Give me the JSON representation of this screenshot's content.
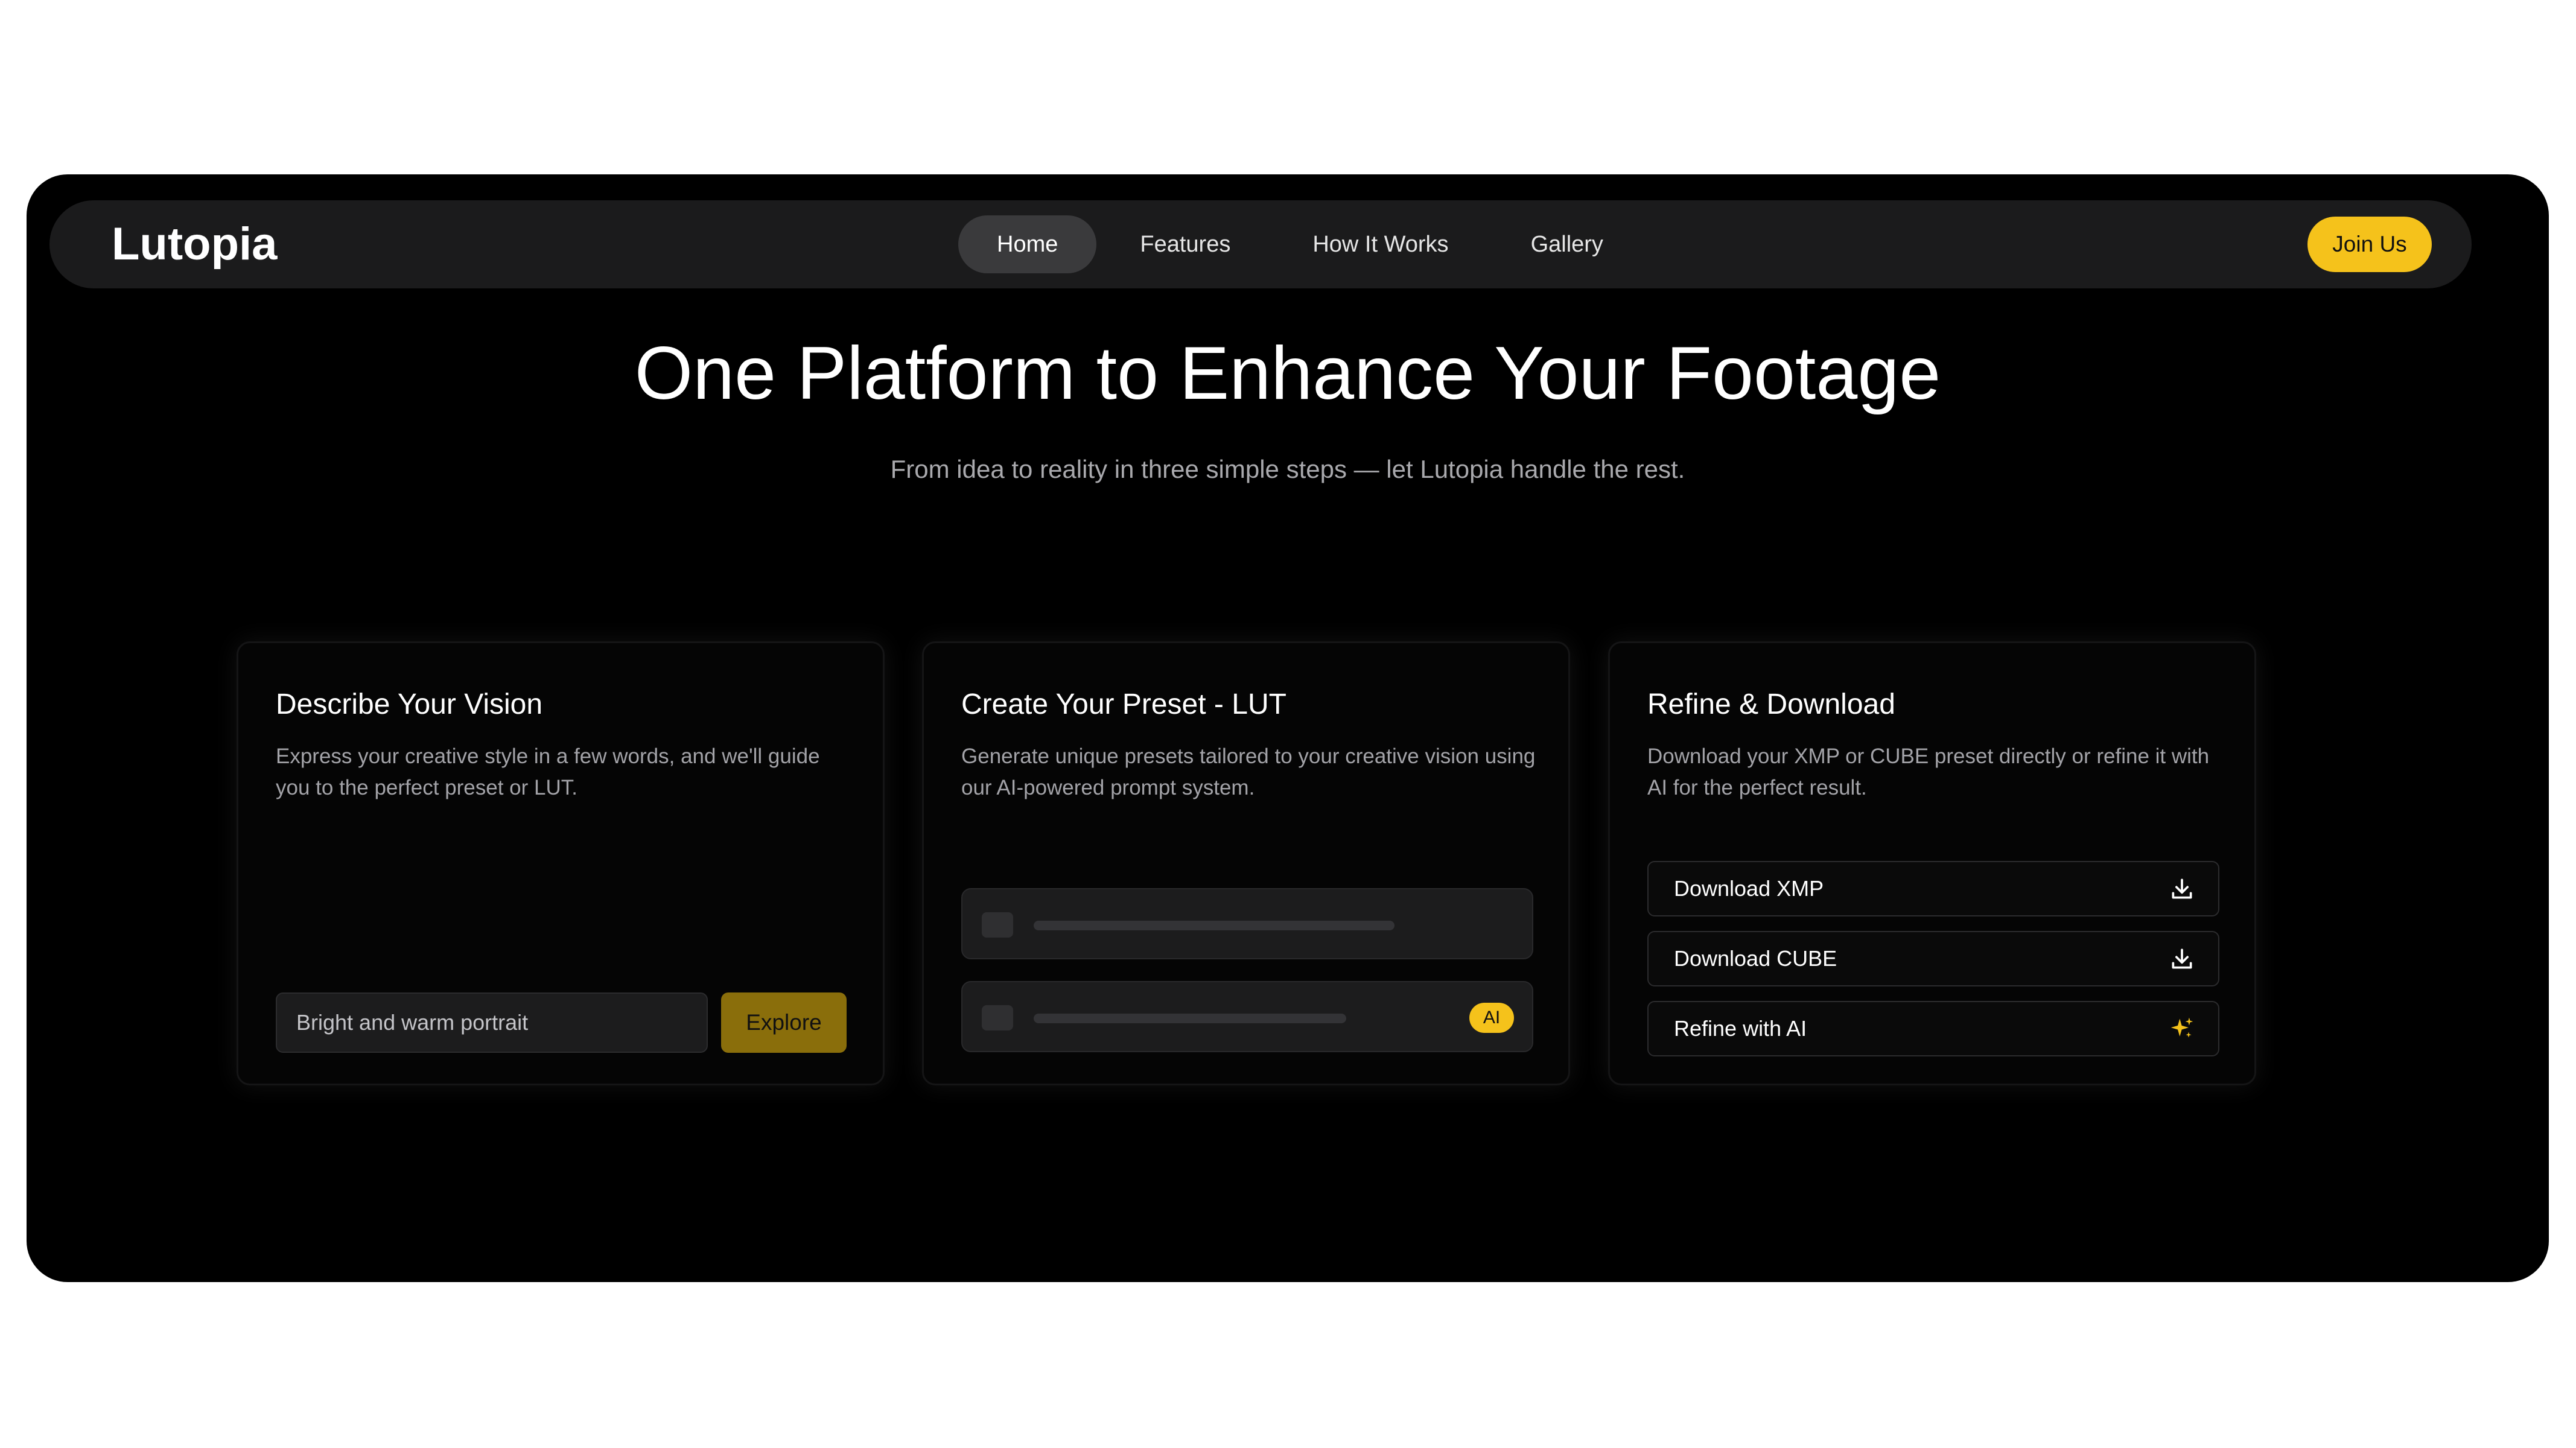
{
  "brand": "Lutopia",
  "nav": {
    "items": [
      {
        "label": "Home",
        "active": true
      },
      {
        "label": "Features",
        "active": false
      },
      {
        "label": "How It Works",
        "active": false
      },
      {
        "label": "Gallery",
        "active": false
      }
    ],
    "join_label": "Join Us"
  },
  "hero": {
    "title": "One Platform to Enhance Your Footage",
    "subtitle": "From idea to reality in three simple steps — let Lutopia handle the rest."
  },
  "cards": [
    {
      "title": "Describe Your Vision",
      "description": "Express your creative style in a few words, and we'll guide you to the perfect preset or LUT.",
      "input_value": "Bright and warm portrait",
      "button_label": "Explore"
    },
    {
      "title": "Create Your Preset - LUT",
      "description": "Generate unique presets tailored to your creative vision using our AI-powered prompt system.",
      "badge": "AI"
    },
    {
      "title": "Refine & Download",
      "description": "Download your XMP or CUBE preset directly or refine it with AI for the perfect result.",
      "actions": [
        {
          "label": "Download XMP",
          "icon": "download-icon"
        },
        {
          "label": "Download CUBE",
          "icon": "download-icon"
        },
        {
          "label": "Refine with AI",
          "icon": "sparkle-icon"
        }
      ]
    }
  ],
  "colors": {
    "accent": "#f5c21b",
    "accent_dim": "#8a6e0b",
    "background": "#000000",
    "navbar": "#1b1b1c"
  }
}
